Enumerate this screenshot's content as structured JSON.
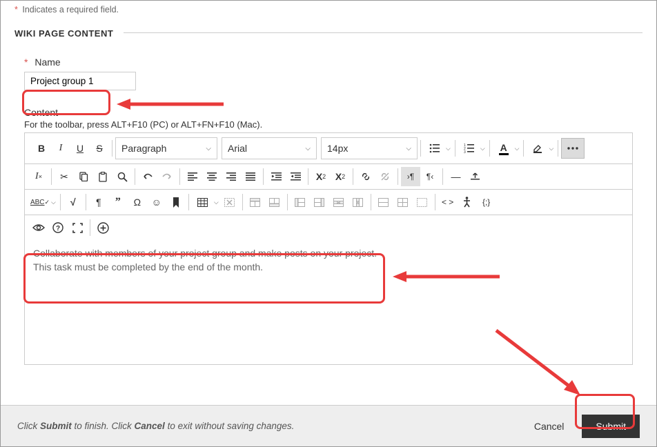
{
  "required_note": "Indicates a required field.",
  "section_title": "WIKI PAGE CONTENT",
  "fields": {
    "name_label": "Name",
    "name_value": "Project group 1",
    "content_label": "Content",
    "toolbar_hint": "For the toolbar, press ALT+F10 (PC) or ALT+FN+F10 (Mac)."
  },
  "toolbar": {
    "paragraph_style": "Paragraph",
    "font_family": "Arial",
    "font_size": "14px"
  },
  "editor": {
    "line1": "Collaborate with members of your project group and make posts on your project.",
    "line2": "This task must be completed by the end of the month."
  },
  "footer": {
    "text_prefix": "Click ",
    "submit_word": "Submit",
    "text_mid": " to finish. Click ",
    "cancel_word": "Cancel",
    "text_suffix": " to exit without saving changes.",
    "cancel_btn": "Cancel",
    "submit_btn": "Submit"
  }
}
